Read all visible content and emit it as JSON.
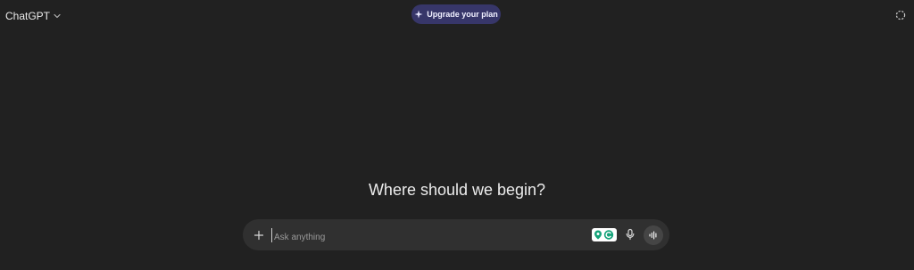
{
  "header": {
    "model_name": "ChatGPT",
    "upgrade_label": "Upgrade your plan"
  },
  "main": {
    "heading": "Where should we begin?"
  },
  "composer": {
    "placeholder": "Ask anything",
    "value": ""
  },
  "icons": {
    "model_chevron": "chevron-down-icon",
    "upgrade": "sparkle-icon",
    "temporary_chat": "dashed-circle-icon",
    "attach": "plus-icon",
    "extension": "grammar-extension-icon",
    "dictate": "microphone-icon",
    "voice_mode": "voice-wave-icon"
  },
  "colors": {
    "background": "#212121",
    "composer": "#303030",
    "upgrade_button": "#373669",
    "extension_green": "#15a37a"
  }
}
